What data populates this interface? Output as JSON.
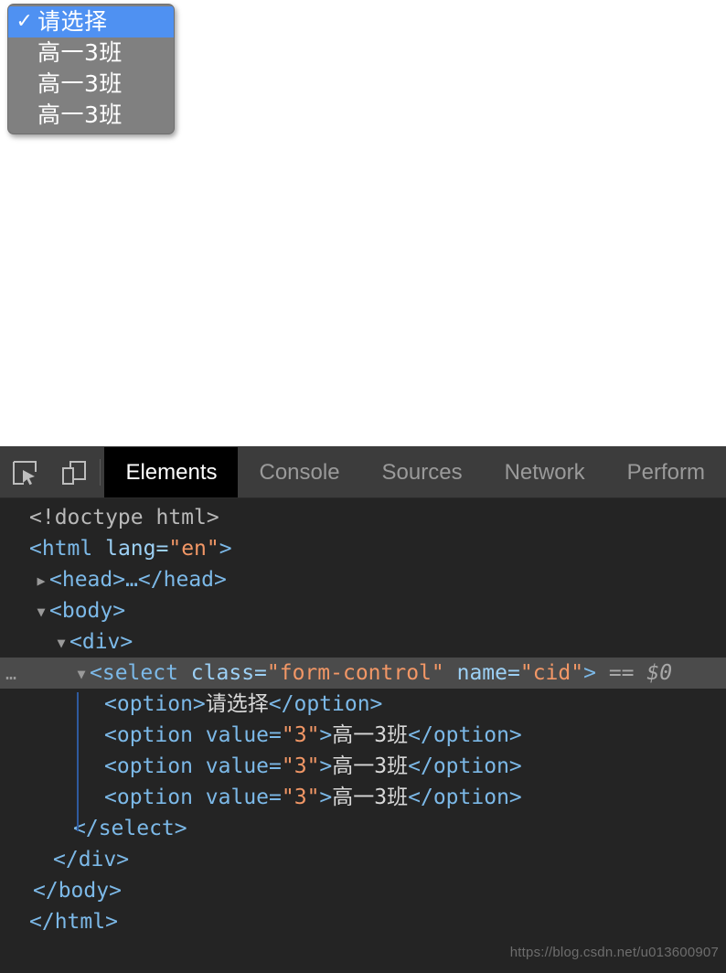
{
  "page": {
    "select_popup": {
      "name": "cid",
      "options": [
        {
          "label": "请选择",
          "selected": true,
          "check": "✓"
        },
        {
          "label": "高一3班",
          "selected": false,
          "check": ""
        },
        {
          "label": "高一3班",
          "selected": false,
          "check": ""
        },
        {
          "label": "高一3班",
          "selected": false,
          "check": ""
        }
      ]
    }
  },
  "devtools": {
    "toolbar": {
      "inspect_icon": "inspect-element-icon",
      "device_icon": "device-toolbar-icon",
      "tabs": [
        {
          "label": "Elements",
          "active": true
        },
        {
          "label": "Console",
          "active": false
        },
        {
          "label": "Sources",
          "active": false
        },
        {
          "label": "Network",
          "active": false
        },
        {
          "label": "Perform",
          "active": false
        }
      ]
    },
    "dom_tree": {
      "gutter_dots": "…",
      "triangle_collapsed": "▶",
      "triangle_expanded": "▼",
      "lines": {
        "doctype": "<!doctype html>",
        "html_open_lt": "<",
        "html_tagname": "html",
        "html_attr": " lang=",
        "html_attrval": "\"en\"",
        "html_gt": ">",
        "head_collapsed": "<head>…</head>",
        "body_open": "<body>",
        "div_open": "<div>",
        "select_lt": "<",
        "select_tagname": "select",
        "select_attr1_name": " class=",
        "select_attr1_val": "\"form-control\"",
        "select_attr2_name": " name=",
        "select_attr2_val": "\"cid\"",
        "select_gt": ">",
        "select_eq": " == ",
        "select_dollar": "$0",
        "opt1_open": "<option>",
        "opt1_text": "请选择",
        "opt1_close": "</option>",
        "opt2_open_a": "<option value=",
        "opt2_val": "\"3\"",
        "opt2_open_b": ">",
        "opt2_text": "高一3班",
        "opt2_close": "</option>",
        "opt3_open_a": "<option value=",
        "opt3_val": "\"3\"",
        "opt3_open_b": ">",
        "opt3_text": "高一3班",
        "opt3_close": "</option>",
        "opt4_open_a": "<option value=",
        "opt4_val": "\"3\"",
        "opt4_open_b": ">",
        "opt4_text": "高一3班",
        "opt4_close": "</option>",
        "select_close": "</select>",
        "div_close": "</div>",
        "body_close": "</body>",
        "html_close": "</html>"
      }
    }
  },
  "watermark": "https://blog.csdn.net/u013600907",
  "colors": {
    "highlight_blue": "#4f91f2",
    "popup_gray": "#808080",
    "devtools_bg": "#242424",
    "toolbar_bg": "#3c3c3c",
    "active_tab_bg": "#000000",
    "attr_value_orange": "#f29766",
    "tag_blue": "#7cb9e8",
    "selected_row_bg": "#4b4b4b"
  }
}
